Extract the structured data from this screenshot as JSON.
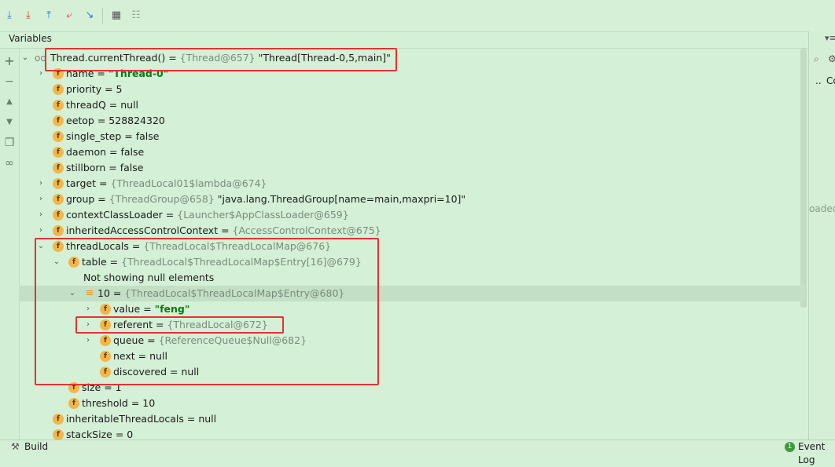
{
  "toolbar": {
    "icons": [
      "step-over-icon",
      "step-into-icon",
      "step-out-icon",
      "drop-frame-icon",
      "run-to-cursor-icon",
      "evaluate-icon",
      "trace-icon"
    ]
  },
  "panel_title": "Variables",
  "right_strip": {
    "text_a": "..",
    "text_b": "Co",
    "text_c": "oaded"
  },
  "rows": [
    {
      "name": "Thread.currentThread()",
      "ref": "{Thread@657}",
      "value": " \"Thread[Thread-0,5,main]\""
    },
    {
      "name": "name",
      "ref": "",
      "value": "\"Thread-0\""
    },
    {
      "name": "priority",
      "ref": "",
      "value": "5"
    },
    {
      "name": "threadQ",
      "ref": "",
      "value": "null"
    },
    {
      "name": "eetop",
      "ref": "",
      "value": "528824320"
    },
    {
      "name": "single_step",
      "ref": "",
      "value": "false"
    },
    {
      "name": "daemon",
      "ref": "",
      "value": "false"
    },
    {
      "name": "stillborn",
      "ref": "",
      "value": "false"
    },
    {
      "name": "target",
      "ref": "{ThreadLocal01$lambda@674}",
      "value": ""
    },
    {
      "name": "group",
      "ref": "{ThreadGroup@658}",
      "value": " \"java.lang.ThreadGroup[name=main,maxpri=10]\""
    },
    {
      "name": "contextClassLoader",
      "ref": "{Launcher$AppClassLoader@659}",
      "value": ""
    },
    {
      "name": "inheritedAccessControlContext",
      "ref": "{AccessControlContext@675}",
      "value": ""
    },
    {
      "name": "threadLocals",
      "ref": "{ThreadLocal$ThreadLocalMap@676}",
      "value": ""
    },
    {
      "name": "table",
      "ref": "{ThreadLocal$ThreadLocalMap$Entry[16]@679}",
      "value": ""
    },
    {
      "name": "Not showing null elements",
      "ref": "",
      "value": ""
    },
    {
      "name": "10",
      "ref": "{ThreadLocal$ThreadLocalMap$Entry@680}",
      "value": ""
    },
    {
      "name": "value",
      "ref": "",
      "value": "\"feng\""
    },
    {
      "name": "referent",
      "ref": "{ThreadLocal@672}",
      "value": ""
    },
    {
      "name": "queue",
      "ref": "{ReferenceQueue$Null@682}",
      "value": ""
    },
    {
      "name": "next",
      "ref": "",
      "value": "null"
    },
    {
      "name": "discovered",
      "ref": "",
      "value": "null"
    },
    {
      "name": "size",
      "ref": "",
      "value": "1"
    },
    {
      "name": "threshold",
      "ref": "",
      "value": "10"
    },
    {
      "name": "inheritableThreadLocals",
      "ref": "",
      "value": "null"
    },
    {
      "name": "stackSize",
      "ref": "",
      "value": "0"
    }
  ],
  "equals": " = ",
  "field_glyph": "f",
  "status": {
    "build": "Build",
    "event_log": "Event Log",
    "event_count": "1"
  },
  "colors": {
    "highlight_box": "#e3342f",
    "background": "#d4f0d6",
    "string_value": "#067d17"
  }
}
